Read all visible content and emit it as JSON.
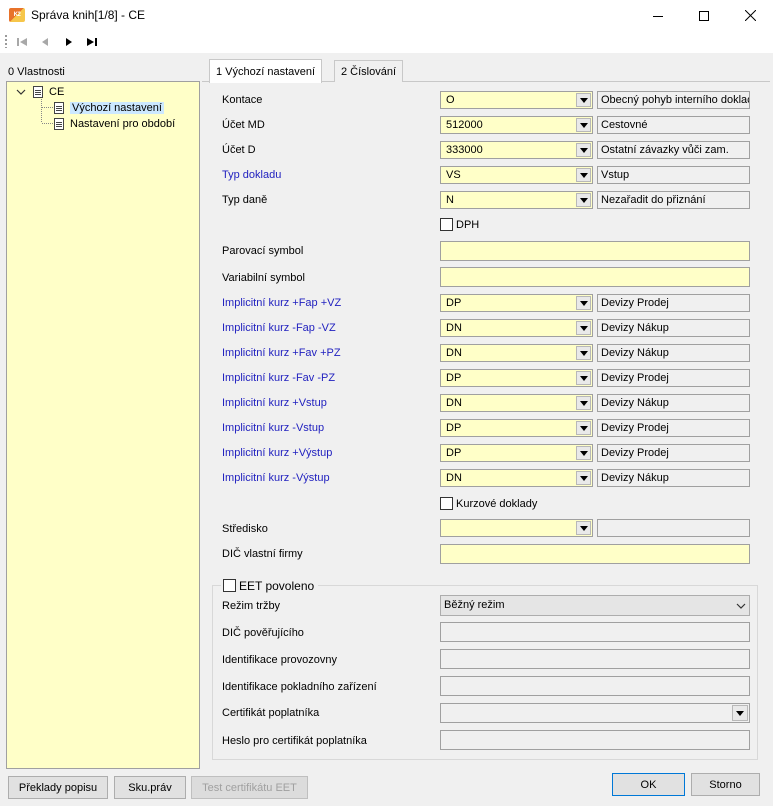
{
  "window": {
    "title": "Správa knih[1/8] - CE",
    "icon_text": "K2"
  },
  "toolbar": {
    "icons": [
      "first-record-icon",
      "previous-record-icon",
      "next-record-icon",
      "last-record-icon"
    ]
  },
  "left_panel": {
    "label": "0 Vlastnosti",
    "tree": {
      "root": "CE",
      "children": [
        "Výchozí nastavení",
        "Nastavení pro období"
      ]
    }
  },
  "tabs": [
    "1 Výchozí nastavení",
    "2 Číslování"
  ],
  "form": {
    "kontace": {
      "label": "Kontace",
      "value": "O",
      "desc": "Obecný pohyb interního doklac"
    },
    "ucet_md": {
      "label": "Účet MD",
      "value": "512000",
      "desc": "Cestovné"
    },
    "ucet_d": {
      "label": "Účet D",
      "value": "333000",
      "desc": "Ostatní závazky vůči zam."
    },
    "typ_dokladu": {
      "label": "Typ dokladu",
      "value": "VS",
      "desc": "Vstup"
    },
    "typ_dane": {
      "label": "Typ daně",
      "value": "N",
      "desc": "Nezařadit do přiznání"
    },
    "dph": {
      "label": "DPH",
      "checked": false
    },
    "parovaci_symbol": {
      "label": "Parovací symbol",
      "value": ""
    },
    "variabilni_symbol": {
      "label": "Variabilní symbol",
      "value": ""
    },
    "kurzy": [
      {
        "label": "Implicitní kurz +Fap +VZ",
        "value": "DP",
        "desc": "Devizy Prodej"
      },
      {
        "label": "Implicitní kurz -Fap -VZ",
        "value": "DN",
        "desc": "Devizy Nákup"
      },
      {
        "label": "Implicitní kurz +Fav +PZ",
        "value": "DN",
        "desc": "Devizy Nákup"
      },
      {
        "label": "Implicitní kurz -Fav -PZ",
        "value": "DP",
        "desc": "Devizy Prodej"
      },
      {
        "label": "Implicitní kurz +Vstup",
        "value": "DN",
        "desc": "Devizy Nákup"
      },
      {
        "label": "Implicitní kurz -Vstup",
        "value": "DP",
        "desc": "Devizy Prodej"
      },
      {
        "label": "Implicitní kurz +Výstup",
        "value": "DP",
        "desc": "Devizy Prodej"
      },
      {
        "label": "Implicitní kurz -Výstup",
        "value": "DN",
        "desc": "Devizy Nákup"
      }
    ],
    "kurzove_doklady": {
      "label": "Kurzové doklady",
      "checked": false
    },
    "stredisko": {
      "label": "Středisko",
      "value": "",
      "desc": ""
    },
    "dic_vlastni_firmy": {
      "label": "DIČ vlastní firmy",
      "value": ""
    }
  },
  "eet": {
    "title": "EET povoleno",
    "checked": false,
    "rezim_trzby": {
      "label": "Režim tržby",
      "value": "Běžný režim"
    },
    "dic_poverujiciho": {
      "label": "DIČ pověřujícího",
      "value": ""
    },
    "identifikace_provozovny": {
      "label": "Identifikace provozovny",
      "value": ""
    },
    "identifikace_pokladniho_zarizeni": {
      "label": "Identifikace pokladního zařízení",
      "value": ""
    },
    "certifikat_poplatnika": {
      "label": "Certifikát poplatníka",
      "value": ""
    },
    "heslo_certifikat": {
      "label": "Heslo pro certifikát poplatníka",
      "value": ""
    }
  },
  "buttons": {
    "preklady_popisu": "Překlady popisu",
    "sku_prav": "Sku.práv",
    "test_certifikatu": "Test certifikátu EET",
    "ok": "OK",
    "storno": "Storno"
  },
  "colors": {
    "input_bg": "#ffffc8",
    "label_blue": "#1f1fbf",
    "window_bg": "#f0f0f0"
  }
}
